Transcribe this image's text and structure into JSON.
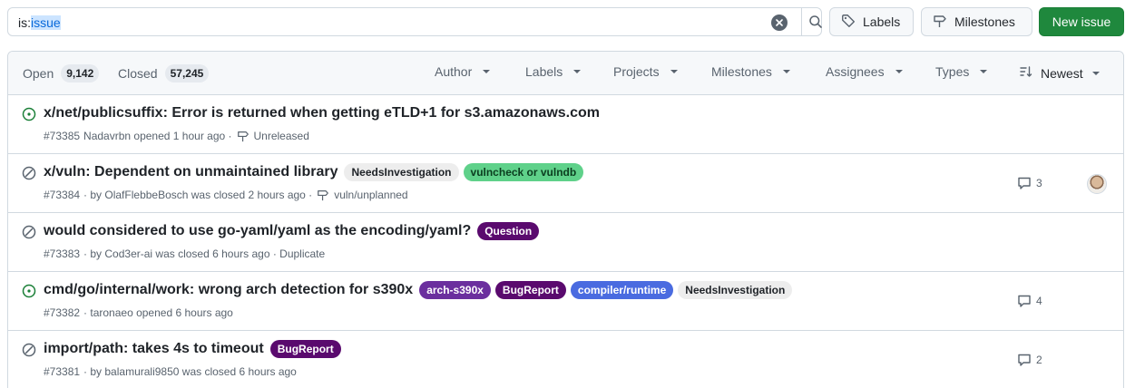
{
  "search": {
    "prefix": "is:",
    "selected": "issue"
  },
  "toolbar": {
    "labels_label": "Labels",
    "milestones_label": "Milestones",
    "new_issue_label": "New issue"
  },
  "header": {
    "open_label": "Open",
    "open_count": "9,142",
    "closed_label": "Closed",
    "closed_count": "57,245",
    "filters": {
      "author": "Author",
      "labels": "Labels",
      "projects": "Projects",
      "milestones": "Milestones",
      "assignees": "Assignees",
      "types": "Types",
      "sort": "Newest"
    }
  },
  "colors": {
    "open": "#1a7f37",
    "closed": "#59636e",
    "primary": "#1f883d"
  },
  "issues": [
    {
      "state": "open",
      "title": "x/net/publicsuffix: Error is returned when getting eTLD+1 for s3.amazonaws.com",
      "labels": [],
      "number": "#73385",
      "meta_text": "Nadavrbn opened 1 hour ago ·",
      "milestone": "Unreleased",
      "comments": ""
    },
    {
      "state": "closed",
      "title": "x/vuln: Dependent on unmaintained library",
      "labels": [
        {
          "name": "NeedsInvestigation",
          "bg": "#ededed",
          "fg": "#1f2328"
        },
        {
          "name": "vulncheck or vulndb",
          "bg": "#5fd18a",
          "fg": "#0b3d1f"
        }
      ],
      "number": "#73384",
      "meta_text": "· by OlafFlebbeBosch was closed 2 hours ago ·",
      "milestone": "vuln/unplanned",
      "comments": "3",
      "avatar": true
    },
    {
      "state": "closed",
      "title": "would considered to use go-yaml/yaml as the encoding/yaml?",
      "labels": [
        {
          "name": "Question",
          "bg": "#5a0a6e",
          "fg": "#ffffff"
        }
      ],
      "number": "#73383",
      "meta_text": "· by Cod3er-ai was closed 6 hours ago · Duplicate",
      "milestone": "",
      "comments": ""
    },
    {
      "state": "open",
      "title": "cmd/go/internal/work: wrong arch detection for s390x",
      "labels": [
        {
          "name": "arch-s390x",
          "bg": "#6b2f9e",
          "fg": "#ffffff"
        },
        {
          "name": "BugReport",
          "bg": "#5a0a6e",
          "fg": "#ffffff"
        },
        {
          "name": "compiler/runtime",
          "bg": "#4a6be0",
          "fg": "#ffffff"
        },
        {
          "name": "NeedsInvestigation",
          "bg": "#ededed",
          "fg": "#1f2328"
        }
      ],
      "number": "#73382",
      "meta_text": "· taronaeo opened 6 hours ago",
      "milestone": "",
      "comments": "4"
    },
    {
      "state": "closed",
      "title": "import/path: takes 4s to timeout",
      "labels": [
        {
          "name": "BugReport",
          "bg": "#5a0a6e",
          "fg": "#ffffff"
        }
      ],
      "number": "#73381",
      "meta_text": "· by balamurali9850 was closed 6 hours ago",
      "milestone": "",
      "comments": "2"
    }
  ]
}
